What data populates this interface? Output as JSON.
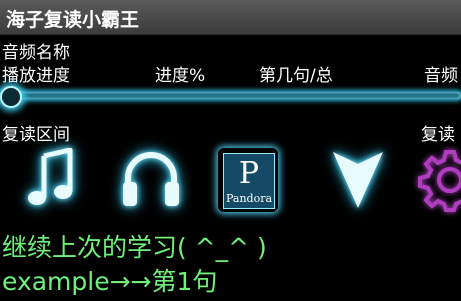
{
  "app": {
    "title": "海子复读小霸王"
  },
  "labels": {
    "track_name": "音频名称",
    "playback_progress": "播放进度",
    "progress_percent": "进度%",
    "sentence_of_total": "第几句/总",
    "audio": "音频",
    "repeat_range": "复读区间",
    "repeat": "复读"
  },
  "progress": {
    "value": 0
  },
  "icons": [
    "music-note-icon",
    "headphones-icon",
    "pandora-icon",
    "down-arrow-icon",
    "gear-icon"
  ],
  "pandora": {
    "letter": "P",
    "text": "Pandora"
  },
  "messages": {
    "continue": "继续上次的学习( ^_^ )",
    "example": "example→→第1句"
  },
  "colors": {
    "accent": "#3fd2f2",
    "message": "#6ff07a",
    "gear": "#b03cc0"
  }
}
